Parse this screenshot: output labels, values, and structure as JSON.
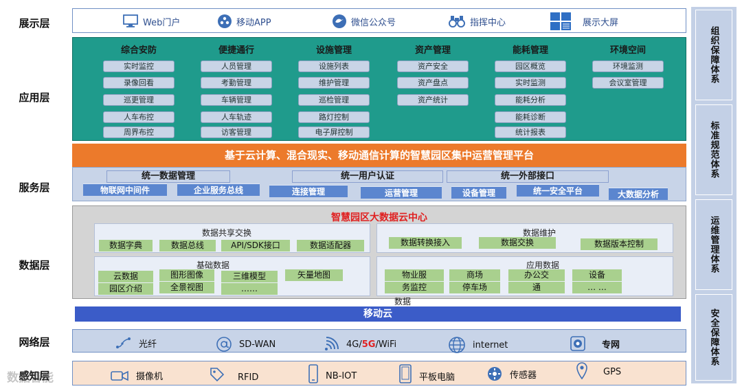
{
  "layers": {
    "presentation": "展示层",
    "application": "应用层",
    "service": "服务层",
    "data": "数据层",
    "network": "网络层",
    "sensing": "感知层"
  },
  "side": [
    "组织保障体系",
    "标准规范体系",
    "运维管理体系",
    "安全保障体系"
  ],
  "presentation_items": [
    {
      "label": "Web门户",
      "icon": "monitor-icon"
    },
    {
      "label": "移动APP",
      "icon": "app-icon"
    },
    {
      "label": "微信公众号",
      "icon": "bird-icon"
    },
    {
      "label": "指挥中心",
      "icon": "binoculars-icon"
    },
    {
      "label": "展示大屏",
      "icon": "grid-screen-icon"
    }
  ],
  "application": [
    {
      "title": "综合安防",
      "items": [
        "实时监控",
        "录像回看",
        "巡更管理",
        "人车布控",
        "周界布控"
      ]
    },
    {
      "title": "便捷通行",
      "items": [
        "人员管理",
        "考勤管理",
        "车辆管理",
        "人车轨迹",
        "访客管理"
      ]
    },
    {
      "title": "设施管理",
      "items": [
        "设施列表",
        "维护管理",
        "巡检管理",
        "路灯控制",
        "电子屏控制"
      ]
    },
    {
      "title": "资产管理",
      "items": [
        "资产安全",
        "资产盘点",
        "资产统计"
      ]
    },
    {
      "title": "能耗管理",
      "items": [
        "园区概览",
        "实时监测",
        "能耗分析",
        "能耗诊断",
        "统计报表"
      ]
    },
    {
      "title": "环境空间",
      "items": [
        "环境监测",
        "会议室管理"
      ]
    }
  ],
  "service": {
    "platform": "基于云计算、混合现实、移动通信计算的智慧园区集中运营管理平台",
    "heads": [
      "统一数据管理",
      "统一用户认证",
      "统一外部接口"
    ],
    "subs": [
      "物联网中间件",
      "企业服务总线",
      "连接管理",
      "运营管理",
      "设备管理",
      "统一安全平台",
      "大数据分析"
    ]
  },
  "data": {
    "title": "智慧园区大数据云中心",
    "share": {
      "label": "数据共享交换",
      "items": [
        "数据字典",
        "数据总线",
        "API/SDK接口",
        "数据适配器"
      ]
    },
    "maintain": {
      "label": "数据维护",
      "items": [
        "数据转换接入",
        "数据交换",
        "数据版本控制"
      ]
    },
    "basic": {
      "label": "基础数据",
      "items": [
        "云数据",
        "图形图像",
        "三维模型",
        "矢量地图",
        "园区介绍",
        "全景视图",
        "……"
      ]
    },
    "appdata": {
      "label": "应用数据",
      "items": [
        "物业服",
        "务监控",
        "数据",
        "商场",
        "停车场",
        "办公交",
        "通",
        "设备",
        "… …"
      ]
    }
  },
  "cloud": "移动云",
  "network_items": [
    {
      "label": "光纤",
      "icon": "fiber-icon"
    },
    {
      "label": "SD-WAN",
      "icon": "at-icon"
    },
    {
      "label_pre": "4G/",
      "label_5g": "5G",
      "label_post": "/WiFi",
      "icon": "wifi-icon"
    },
    {
      "label": "internet",
      "icon": "globe-icon"
    },
    {
      "label": "专网",
      "icon": "private-network-icon"
    }
  ],
  "sensing_items": [
    {
      "label": "摄像机",
      "icon": "camera-icon"
    },
    {
      "label": "RFID",
      "icon": "tag-icon"
    },
    {
      "label": "NB-IOT",
      "icon": "phone-icon"
    },
    {
      "label": "平板电脑",
      "icon": "tablet-icon"
    },
    {
      "label": "传感器",
      "icon": "sensor-icon"
    },
    {
      "label": "GPS",
      "icon": "location-icon"
    }
  ],
  "watermark": "数据智能"
}
